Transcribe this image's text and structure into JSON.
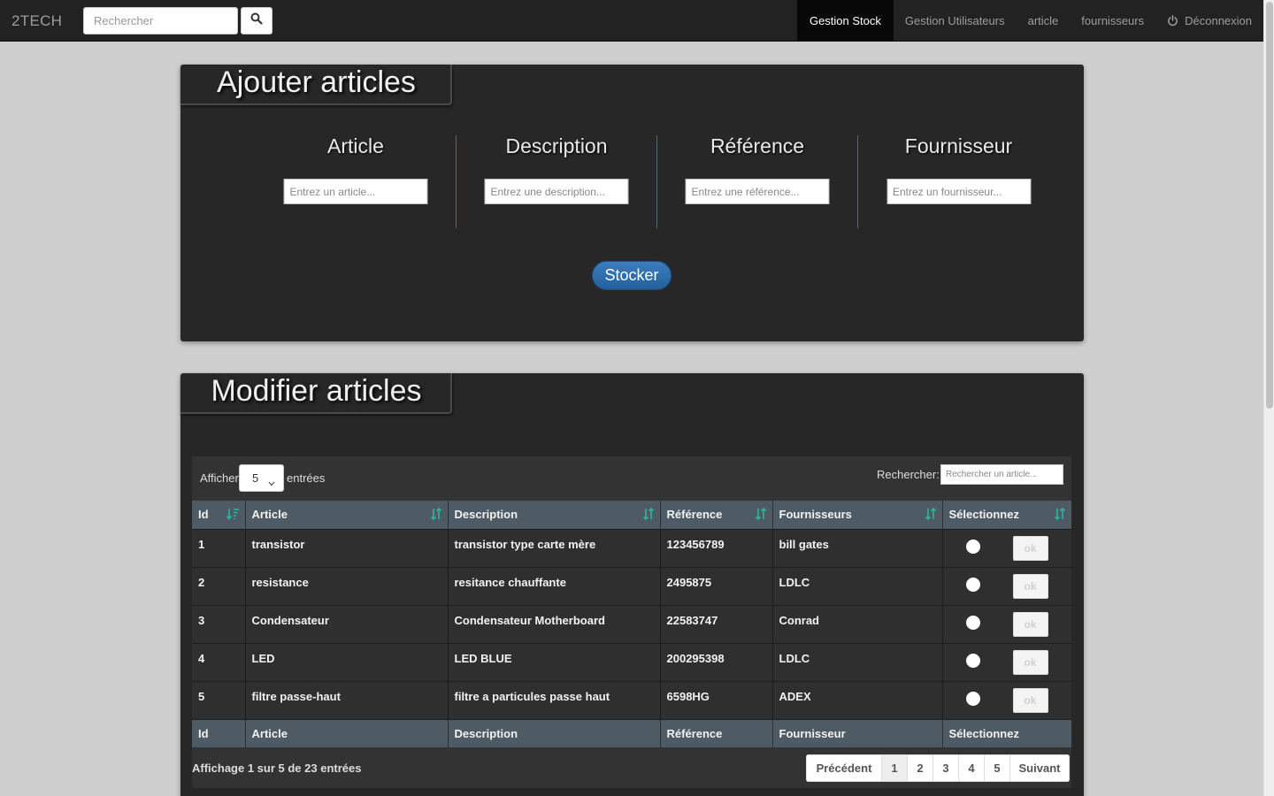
{
  "navbar": {
    "brand": "2TECH",
    "search_placeholder": "Rechercher",
    "items": [
      {
        "label": "Gestion Stock",
        "active": true
      },
      {
        "label": "Gestion Utilisateurs"
      },
      {
        "label": "article"
      },
      {
        "label": "fournisseurs"
      },
      {
        "label": "Déconnexion",
        "icon": "power-icon"
      }
    ]
  },
  "add_panel": {
    "title": "Ajouter articles",
    "fields": [
      {
        "label": "Article",
        "placeholder": "Entrez un article..."
      },
      {
        "label": "Description",
        "placeholder": "Entrez une description..."
      },
      {
        "label": "Référence",
        "placeholder": "Entrez une référence..."
      },
      {
        "label": "Fournisseur",
        "placeholder": "Entrez un fournisseur..."
      }
    ],
    "submit_label": "Stocker"
  },
  "edit_panel": {
    "title": "Modifier articles",
    "length": {
      "before": "Afficher",
      "value": "5",
      "after": "entrées"
    },
    "search": {
      "label": "Rechercher:",
      "placeholder": "Rechercher un article..."
    },
    "columns": [
      "Id",
      "Article",
      "Description",
      "Référence",
      "Fournisseurs",
      "Sélectionnez"
    ],
    "footer_columns": [
      "Id",
      "Article",
      "Description",
      "Référence",
      "Fournisseur",
      "Sélectionnez"
    ],
    "rows": [
      [
        "1",
        "transistor",
        "transistor type carte mère",
        "123456789",
        "bill gates"
      ],
      [
        "2",
        "resistance",
        "resitance chauffante",
        "2495875",
        "LDLC"
      ],
      [
        "3",
        "Condensateur",
        "Condensateur Motherboard",
        "22583747",
        "Conrad"
      ],
      [
        "4",
        "LED",
        "LED BLUE",
        "200295398",
        "LDLC"
      ],
      [
        "5",
        "filtre passe-haut",
        "filtre a particules passe haut",
        "6598HG",
        "ADEX"
      ]
    ],
    "ok_label": "ok",
    "info": "Affichage 1 sur 5 de 23 entrées",
    "pagination": {
      "prev": "Précédent",
      "pages": [
        "1",
        "2",
        "3",
        "4",
        "5"
      ],
      "current": "1",
      "next": "Suivant"
    }
  },
  "colors": {
    "accent": "#2e6da4",
    "sort_icon": "#2bb5a0",
    "navbar": "#222222"
  }
}
